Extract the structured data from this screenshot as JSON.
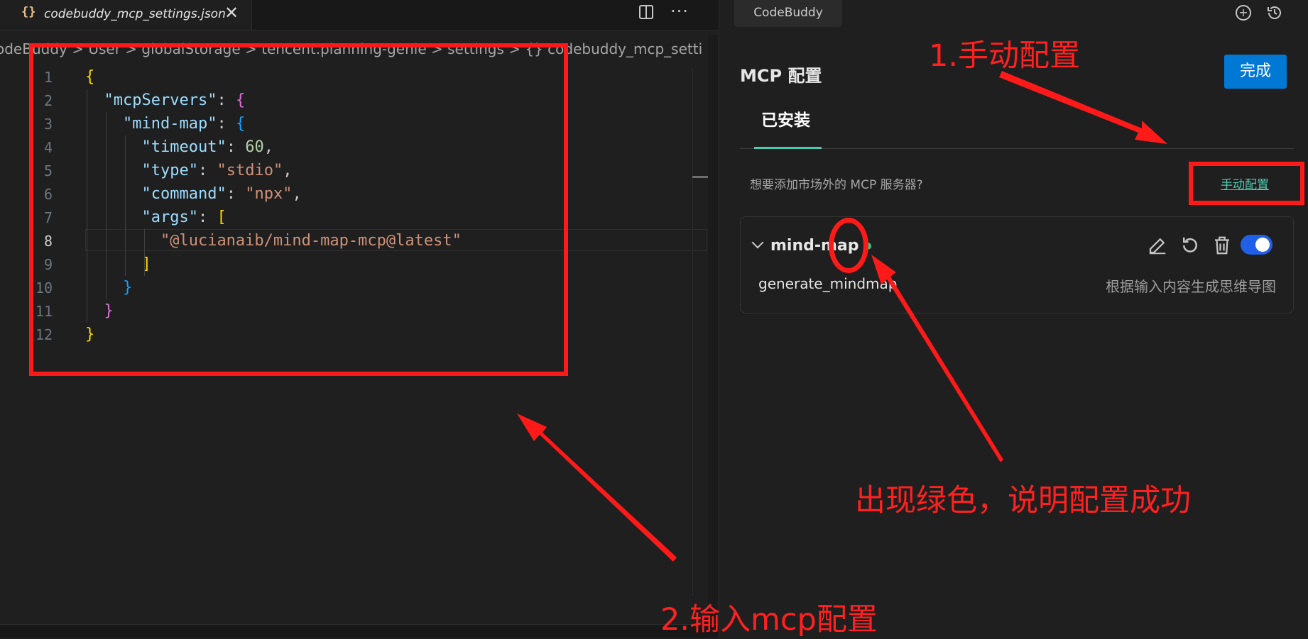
{
  "editor": {
    "tab": {
      "icon": "json-braces-icon",
      "filename": "codebuddy_mcp_settings.json"
    },
    "breadcrumb": "odeBuddy > User > globalStorage > tencent.planning-genie > settings > {} codebuddy_mcp_setti",
    "active_line": 8,
    "lines": [
      {
        "num": "1",
        "tokens": [
          [
            "b1",
            "{"
          ]
        ]
      },
      {
        "num": "2",
        "tokens": [
          [
            "plain",
            "  "
          ],
          [
            "key",
            "\"mcpServers\""
          ],
          [
            "plain",
            ": "
          ],
          [
            "b2",
            "{"
          ]
        ]
      },
      {
        "num": "3",
        "tokens": [
          [
            "plain",
            "    "
          ],
          [
            "key",
            "\"mind-map\""
          ],
          [
            "plain",
            ": "
          ],
          [
            "b3",
            "{"
          ]
        ]
      },
      {
        "num": "4",
        "tokens": [
          [
            "plain",
            "      "
          ],
          [
            "key",
            "\"timeout\""
          ],
          [
            "plain",
            ": "
          ],
          [
            "num",
            "60"
          ],
          [
            "plain",
            ","
          ]
        ]
      },
      {
        "num": "5",
        "tokens": [
          [
            "plain",
            "      "
          ],
          [
            "key",
            "\"type\""
          ],
          [
            "plain",
            ": "
          ],
          [
            "str",
            "\"stdio\""
          ],
          [
            "plain",
            ","
          ]
        ]
      },
      {
        "num": "6",
        "tokens": [
          [
            "plain",
            "      "
          ],
          [
            "key",
            "\"command\""
          ],
          [
            "plain",
            ": "
          ],
          [
            "str",
            "\"npx\""
          ],
          [
            "plain",
            ","
          ]
        ]
      },
      {
        "num": "7",
        "tokens": [
          [
            "plain",
            "      "
          ],
          [
            "key",
            "\"args\""
          ],
          [
            "plain",
            ": "
          ],
          [
            "b1",
            "["
          ]
        ]
      },
      {
        "num": "8",
        "tokens": [
          [
            "plain",
            "        "
          ],
          [
            "str",
            "\"@lucianaib/mind-map-mcp@latest\""
          ]
        ]
      },
      {
        "num": "9",
        "tokens": [
          [
            "plain",
            "      "
          ],
          [
            "b1",
            "]"
          ]
        ]
      },
      {
        "num": "10",
        "tokens": [
          [
            "plain",
            "    "
          ],
          [
            "b3",
            "}"
          ]
        ]
      },
      {
        "num": "11",
        "tokens": [
          [
            "plain",
            "  "
          ],
          [
            "b2",
            "}"
          ]
        ]
      },
      {
        "num": "12",
        "tokens": [
          [
            "b1",
            "}"
          ]
        ]
      }
    ],
    "icons": {
      "split": "split-editor-icon",
      "more": "more-actions-icon",
      "close": "close-icon"
    }
  },
  "panel": {
    "tab_label": "CodeBuddy",
    "title": "MCP 配置",
    "done_button": "完成",
    "installed_tab": "已安装",
    "add_question": "想要添加市场外的 MCP 服务器?",
    "manual_link": "手动配置",
    "server": {
      "name": "mind-map",
      "status_color": "#23d18b",
      "enabled": true,
      "tool": {
        "name": "generate_mindmap",
        "description": "根据输入内容生成思维导图"
      }
    },
    "accent": "#0078d4"
  },
  "annotations": {
    "step1": "1.手动配置",
    "step2": "2.输入mcp配置",
    "success_note": "出现绿色，说明配置成功",
    "color": "#ff1a1a"
  }
}
